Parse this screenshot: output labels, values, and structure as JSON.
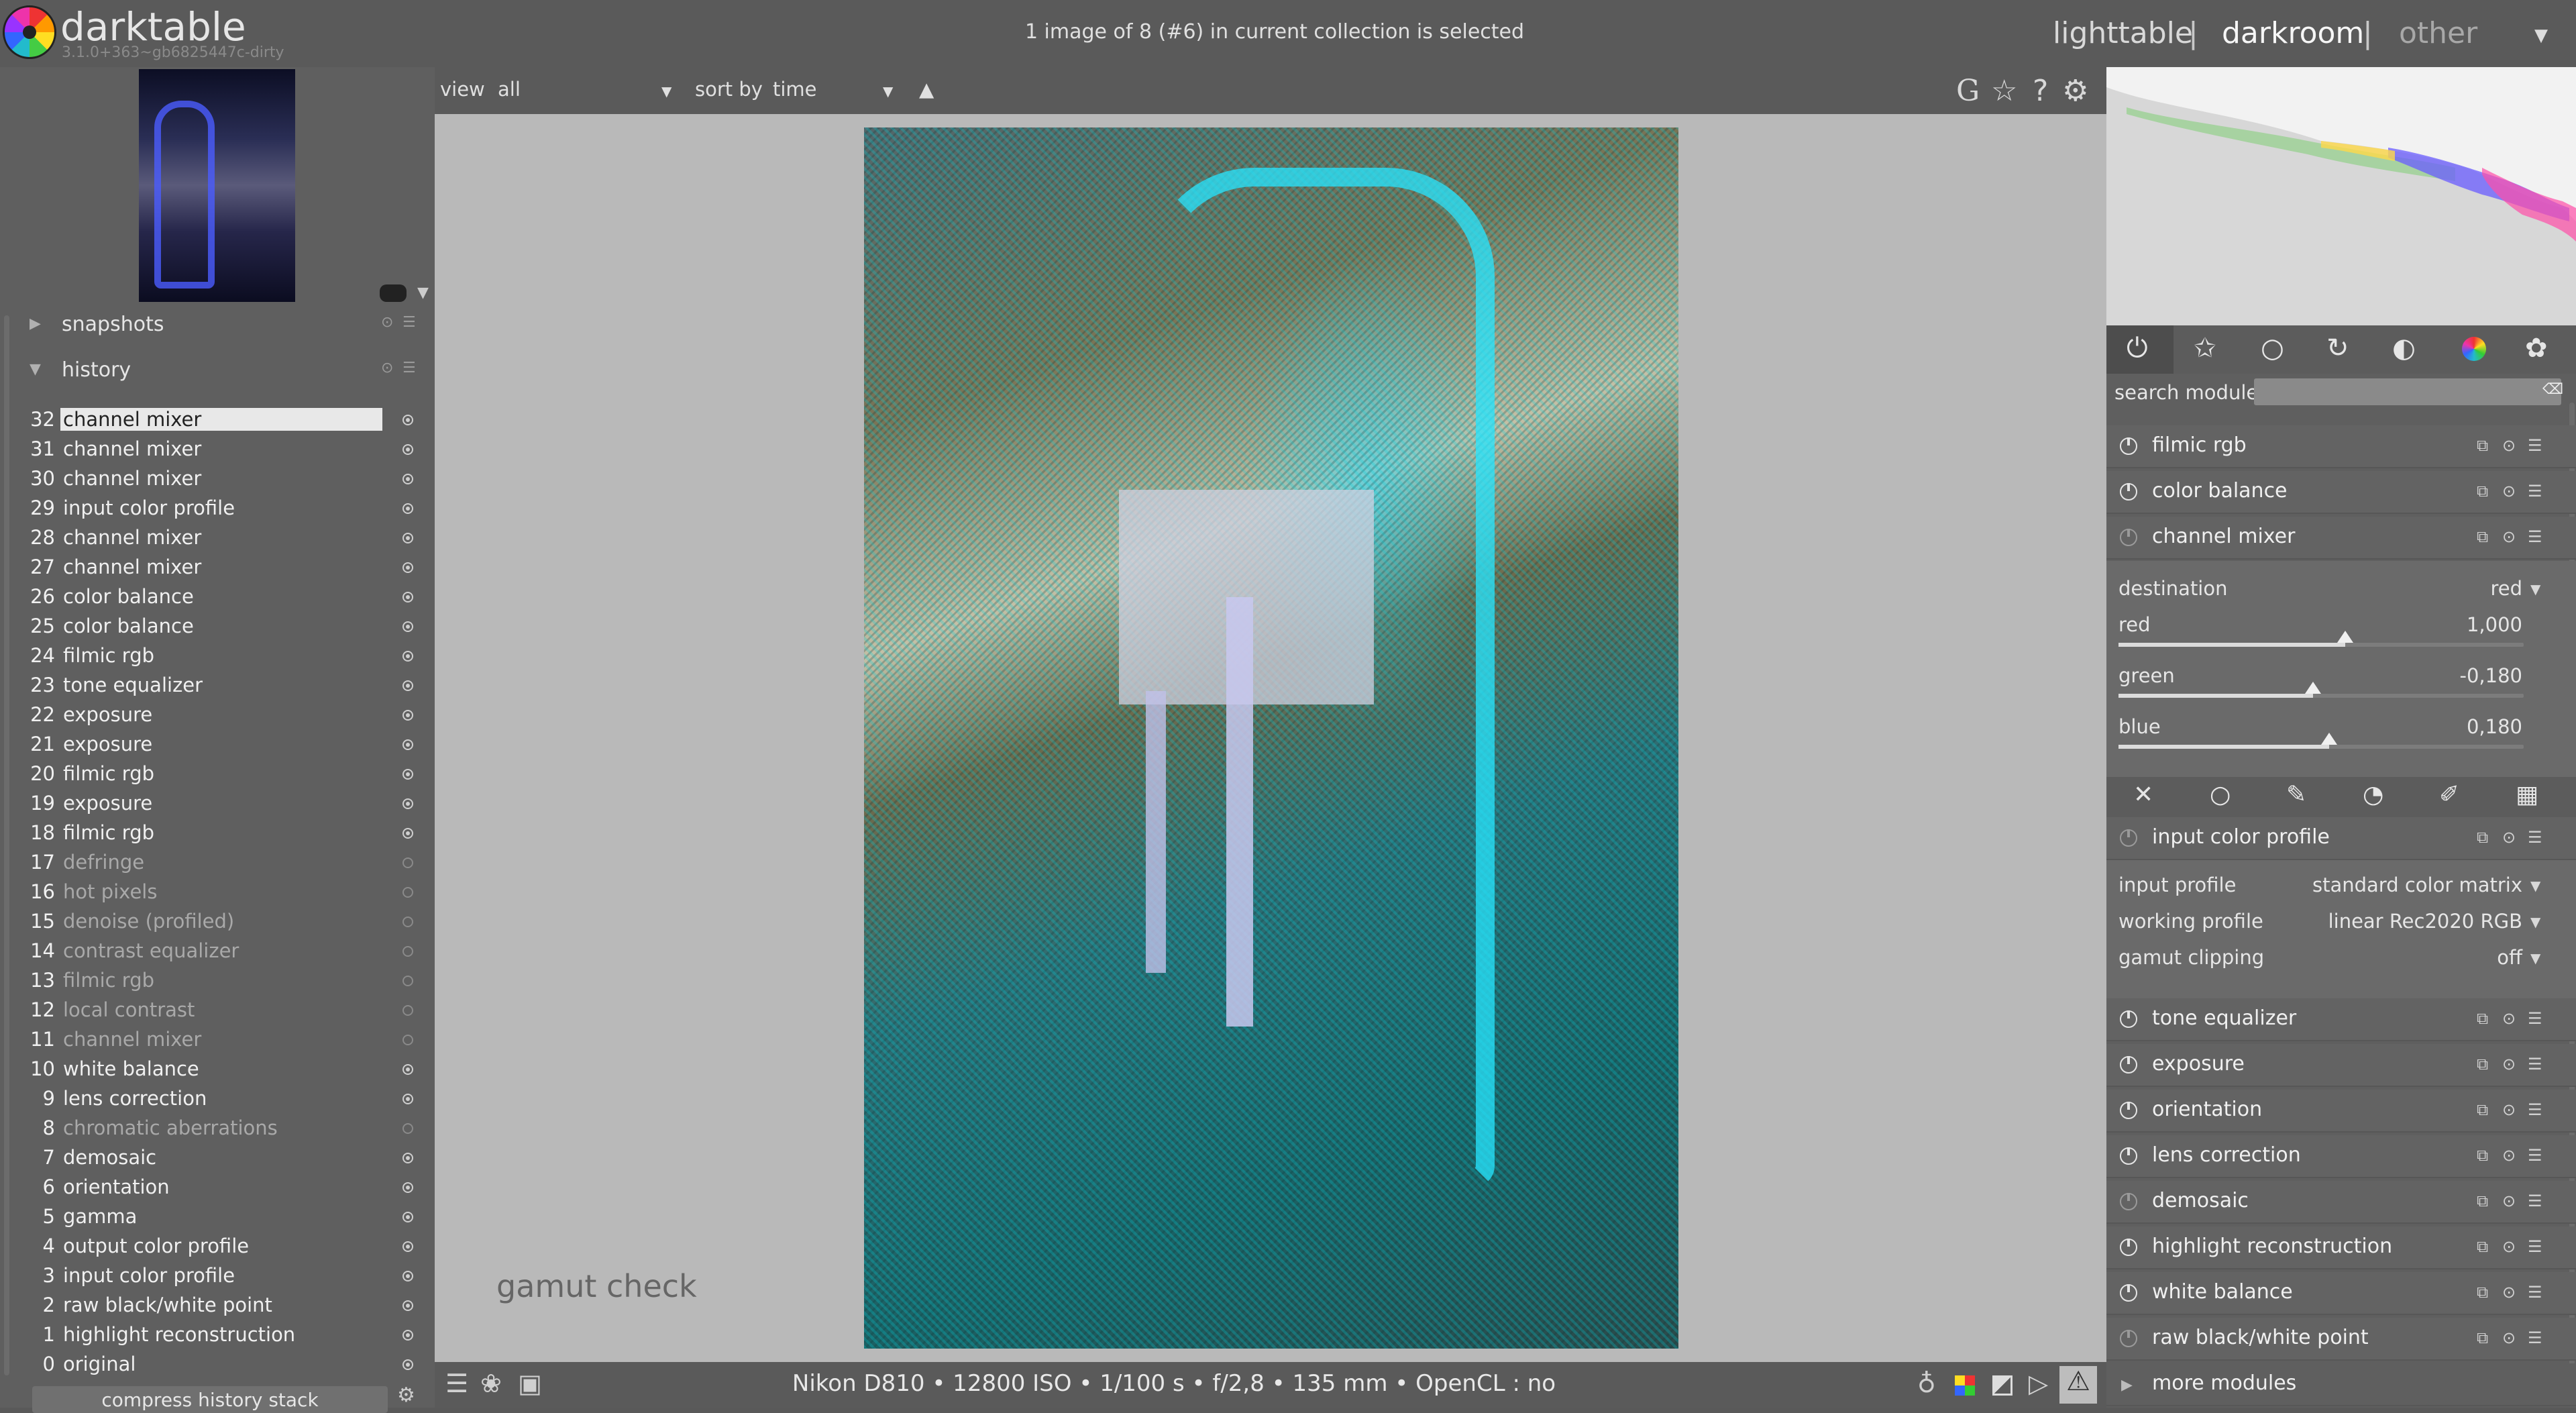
{
  "app": {
    "name": "darktable",
    "version": "3.1.0+363~gb6825447c-dirty"
  },
  "status": "1 image of 8 (#6) in current collection is selected",
  "views": {
    "lighttable": "lighttable",
    "darkroom": "darkroom",
    "other": "other",
    "separator": "|"
  },
  "left_panel": {
    "snapshots_label": "snapshots",
    "history_label": "history",
    "history": [
      {
        "num": "32",
        "label": "channel mixer",
        "enabled": true,
        "selected": true
      },
      {
        "num": "31",
        "label": "channel mixer",
        "enabled": true
      },
      {
        "num": "30",
        "label": "channel mixer",
        "enabled": true
      },
      {
        "num": "29",
        "label": "input color profile",
        "enabled": true
      },
      {
        "num": "28",
        "label": "channel mixer",
        "enabled": true
      },
      {
        "num": "27",
        "label": "channel mixer",
        "enabled": true
      },
      {
        "num": "26",
        "label": "color balance",
        "enabled": true
      },
      {
        "num": "25",
        "label": "color balance",
        "enabled": true
      },
      {
        "num": "24",
        "label": "filmic rgb",
        "enabled": true
      },
      {
        "num": "23",
        "label": "tone equalizer",
        "enabled": true
      },
      {
        "num": "22",
        "label": "exposure",
        "enabled": true
      },
      {
        "num": "21",
        "label": "exposure",
        "enabled": true
      },
      {
        "num": "20",
        "label": "filmic rgb",
        "enabled": true
      },
      {
        "num": "19",
        "label": "exposure",
        "enabled": true
      },
      {
        "num": "18",
        "label": "filmic rgb",
        "enabled": true
      },
      {
        "num": "17",
        "label": "defringe",
        "enabled": false
      },
      {
        "num": "16",
        "label": "hot pixels",
        "enabled": false
      },
      {
        "num": "15",
        "label": "denoise (profiled)",
        "enabled": false
      },
      {
        "num": "14",
        "label": "contrast equalizer",
        "enabled": false
      },
      {
        "num": "13",
        "label": "filmic rgb",
        "enabled": false
      },
      {
        "num": "12",
        "label": "local contrast",
        "enabled": false
      },
      {
        "num": "11",
        "label": "channel mixer",
        "enabled": false
      },
      {
        "num": "10",
        "label": "white balance",
        "enabled": true
      },
      {
        "num": "9",
        "label": "lens correction",
        "enabled": true
      },
      {
        "num": "8",
        "label": "chromatic aberrations",
        "enabled": false
      },
      {
        "num": "7",
        "label": "demosaic",
        "enabled": true
      },
      {
        "num": "6",
        "label": "orientation",
        "enabled": true
      },
      {
        "num": "5",
        "label": "gamma",
        "enabled": true
      },
      {
        "num": "4",
        "label": "output color profile",
        "enabled": true
      },
      {
        "num": "3",
        "label": "input color profile",
        "enabled": true
      },
      {
        "num": "2",
        "label": "raw black/white point",
        "enabled": true
      },
      {
        "num": "1",
        "label": "highlight reconstruction",
        "enabled": true
      },
      {
        "num": "0",
        "label": "original",
        "enabled": true
      }
    ],
    "compress_label": "compress history stack"
  },
  "toolbar": {
    "view_label": "view",
    "view_value": "all",
    "sort_label": "sort by",
    "sort_value": "time",
    "sort_direction": "▲",
    "icons": {
      "gamut": "G",
      "star": "☆",
      "help": "?",
      "prefs": "⚙"
    }
  },
  "canvas": {
    "overlay": "gamut check"
  },
  "bottom": {
    "exif": "Nikon D810 •  12800 ISO • 1/100 s • f/2,8 • 135 mm  • OpenCL : no"
  },
  "right_panel": {
    "search_label": "search module",
    "modules_top": [
      "filmic rgb",
      "color balance",
      "channel mixer"
    ],
    "channel_mixer": {
      "destination_label": "destination",
      "destination_value": "red",
      "sliders": [
        {
          "label": "red",
          "value": "1,000",
          "fraction": 0.56
        },
        {
          "label": "green",
          "value": "-0,180",
          "fraction": 0.48
        },
        {
          "label": "blue",
          "value": "0,180",
          "fraction": 0.52
        }
      ]
    },
    "input_color_profile": {
      "name": "input color profile",
      "params": [
        {
          "label": "input profile",
          "value": "standard color matrix"
        },
        {
          "label": "working profile",
          "value": "linear Rec2020 RGB"
        },
        {
          "label": "gamut clipping",
          "value": "off"
        }
      ]
    },
    "modules_bottom": [
      "tone equalizer",
      "exposure",
      "orientation",
      "lens correction",
      "demosaic",
      "highlight reconstruction",
      "white balance",
      "raw black/white point"
    ],
    "more_modules": "more modules"
  }
}
